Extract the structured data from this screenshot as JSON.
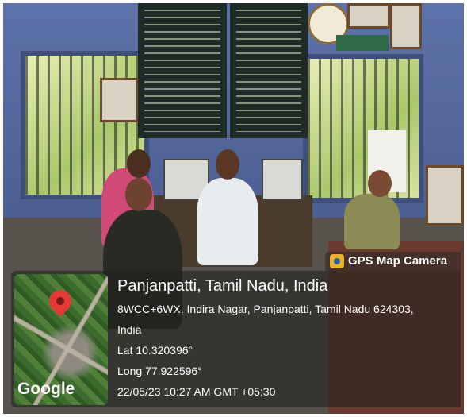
{
  "gps_badge": {
    "label": "GPS Map Camera",
    "icon": "camera-pin-icon"
  },
  "map": {
    "brand": "Google",
    "pin_icon": "location-pin-icon"
  },
  "location": {
    "title": "Panjanpatti, Tamil Nadu, India",
    "address_line1": "8WCC+6WX, Indira Nagar, Panjanpatti, Tamil Nadu 624303,",
    "address_line2": "India",
    "lat": "Lat 10.320396°",
    "long": "Long 77.922596°",
    "datetime": "22/05/23 10:27 AM GMT +05:30"
  },
  "colors": {
    "overlay": "#1e1e1e",
    "pin": "#e53935",
    "wall": "#5d72a8"
  }
}
